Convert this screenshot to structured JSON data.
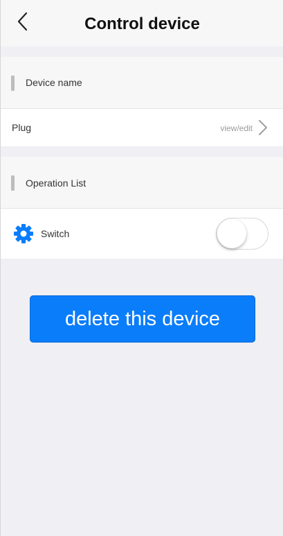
{
  "header": {
    "title": "Control device",
    "back_icon": "chevron-left-icon"
  },
  "device_section": {
    "label": "Device name",
    "row": {
      "name": "Plug",
      "hint": "view/edit",
      "icon": "chevron-right-icon"
    }
  },
  "operation_section": {
    "label": "Operation List",
    "row": {
      "label": "Switch",
      "icon": "gear-icon",
      "toggle_on": false
    }
  },
  "actions": {
    "delete_label": "delete this device"
  },
  "colors": {
    "accent": "#0a7dfb",
    "background": "#efeff4"
  }
}
